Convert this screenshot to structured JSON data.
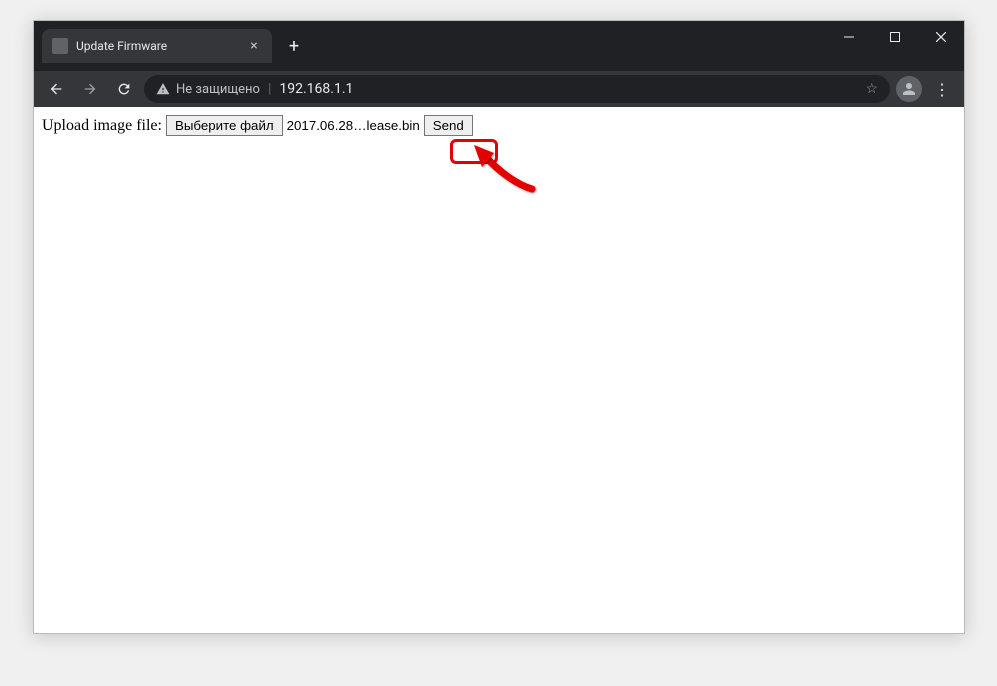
{
  "window": {
    "tab_title": "Update Firmware"
  },
  "toolbar": {
    "security_text": "Не защищено",
    "url": "192.168.1.1"
  },
  "content": {
    "label": "Upload image file:",
    "choose_file_label": "Выберите файл",
    "selected_filename": "2017.06.28…lease.bin",
    "send_label": "Send"
  },
  "icons": {
    "close_x": "×",
    "plus": "+",
    "separator": "|",
    "menu": "⋮",
    "star": "☆"
  },
  "annotation": {
    "highlight_color": "#e30000"
  }
}
